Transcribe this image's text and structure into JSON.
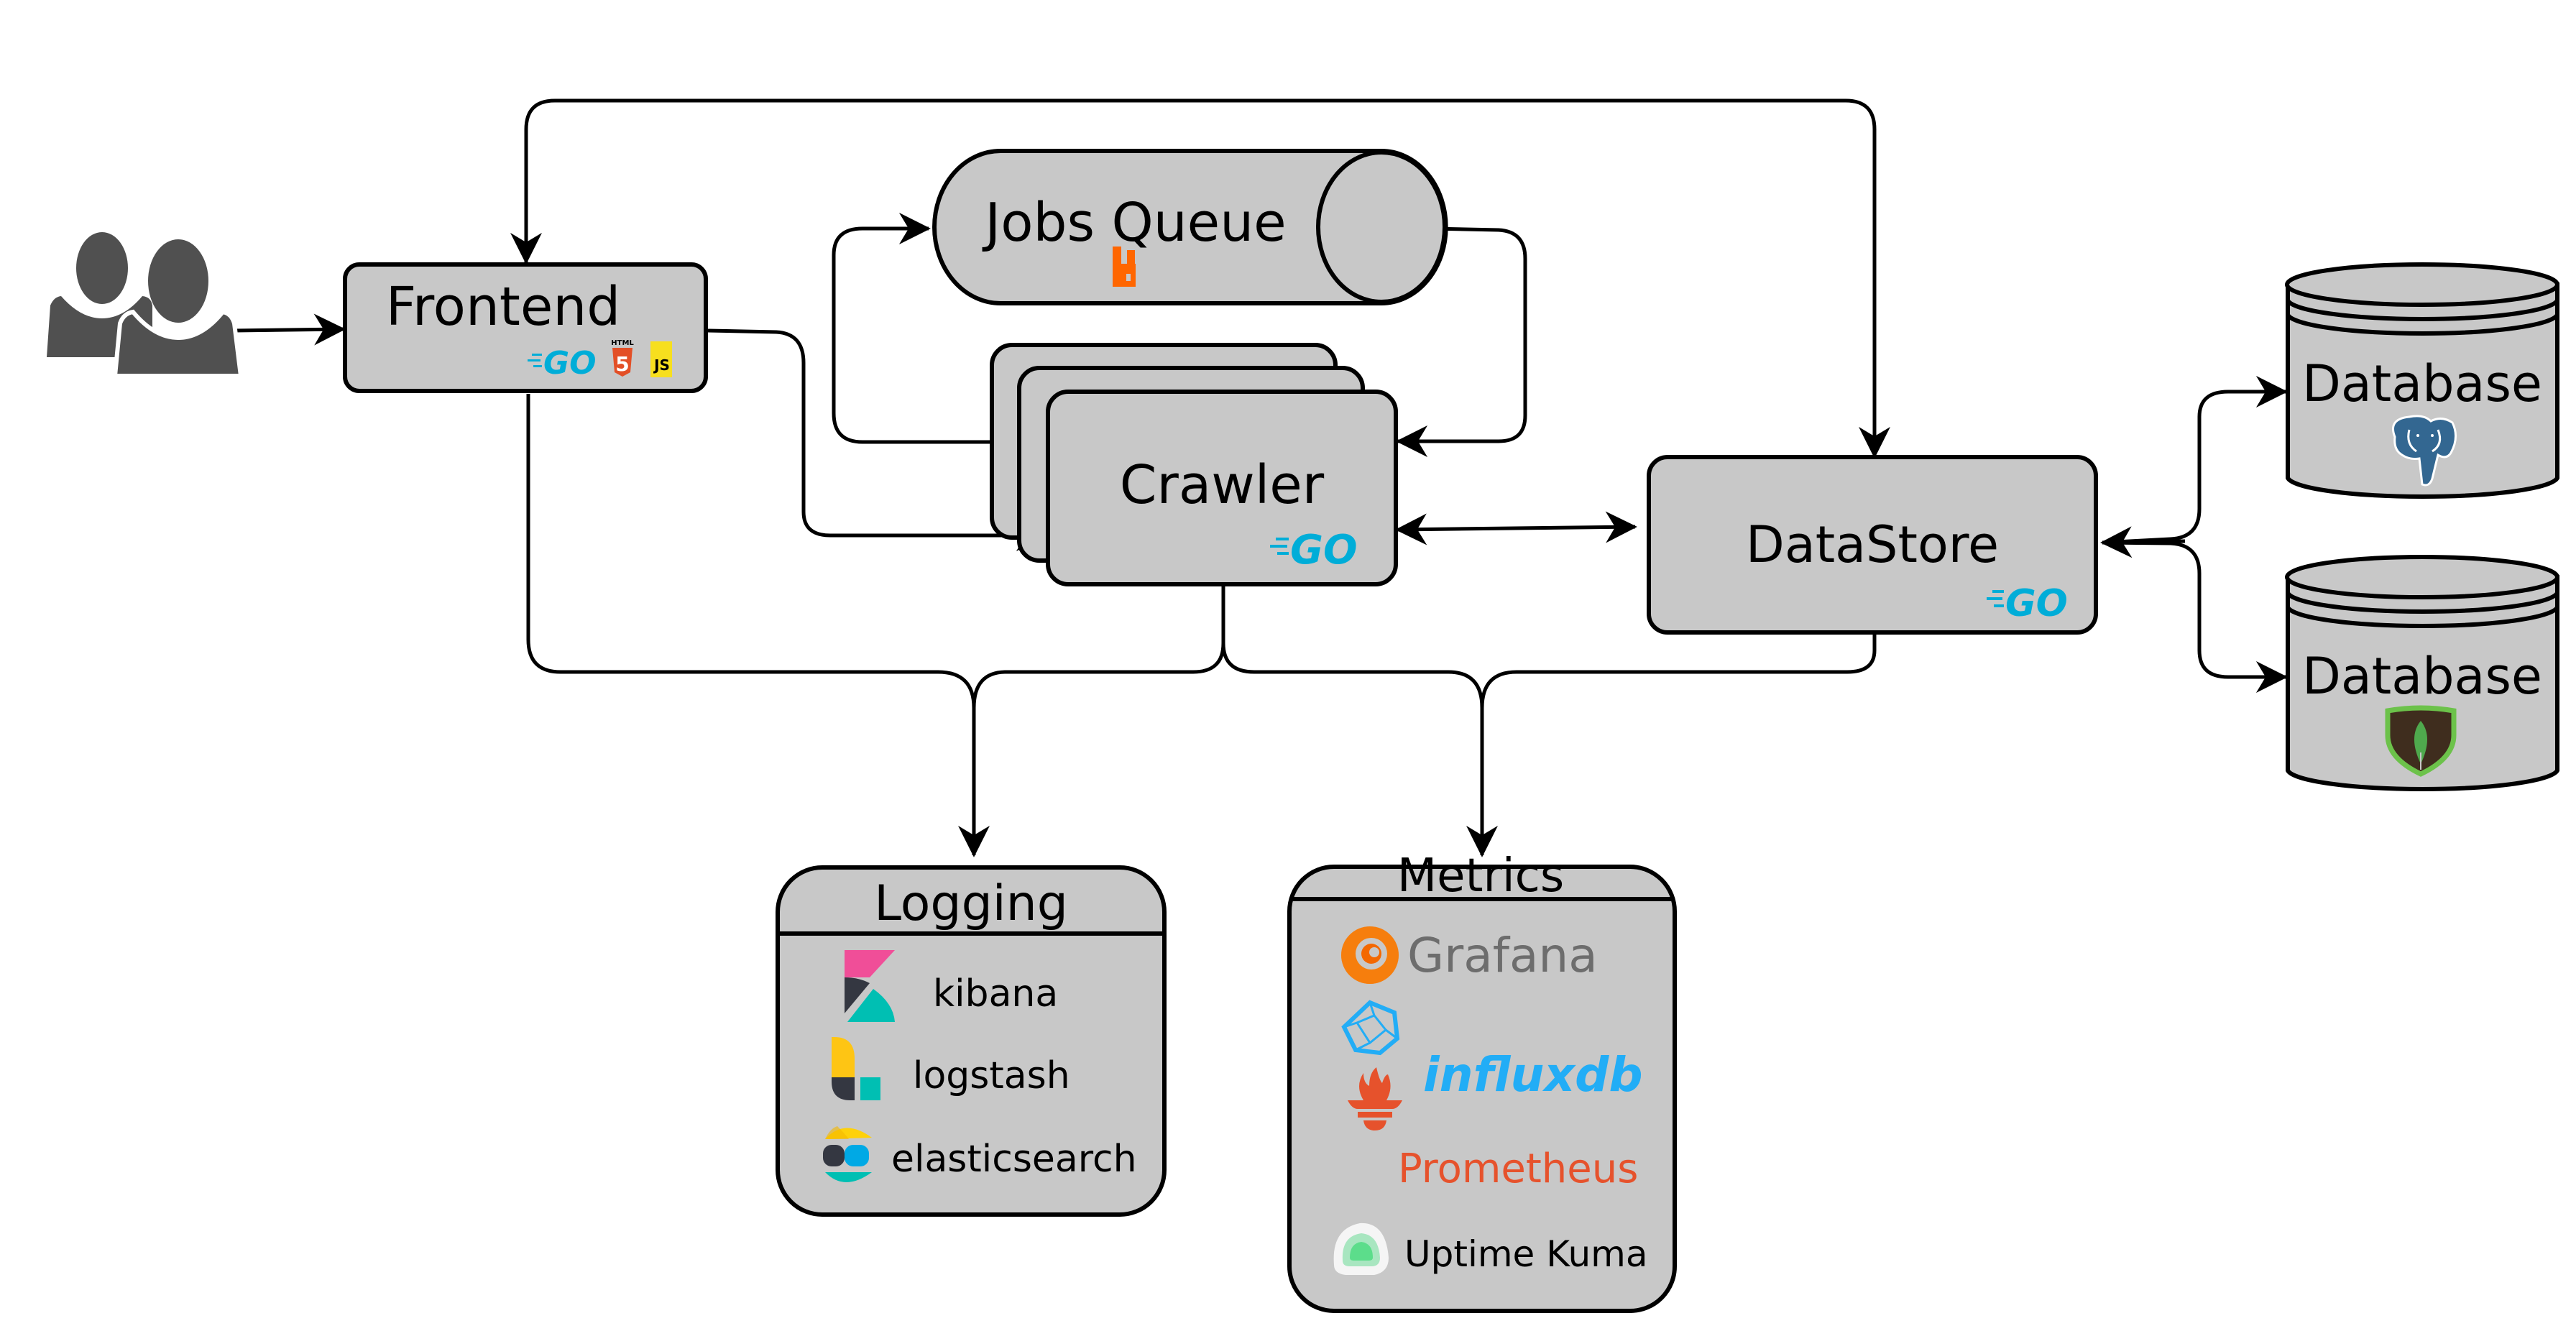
{
  "users": {
    "icon": "users-icon"
  },
  "frontend": {
    "label": "Frontend",
    "tech": [
      "go-logo",
      "html5-logo",
      "javascript-logo"
    ],
    "html5_caption": "HTML",
    "html5_digit": "5",
    "js_text": "JS"
  },
  "jobs_queue": {
    "label": "Jobs Queue",
    "tech": [
      "rabbitmq-logo"
    ]
  },
  "crawler": {
    "label": "Crawler",
    "tech": [
      "go-logo"
    ],
    "instances_shown": 3
  },
  "datastore": {
    "label": "DataStore",
    "tech": [
      "go-logo"
    ]
  },
  "databases": [
    {
      "label": "Database",
      "tech": "postgresql-logo"
    },
    {
      "label": "Database",
      "tech": "mongodb-logo"
    }
  ],
  "logging": {
    "title": "Logging",
    "tools": [
      {
        "name": "kibana",
        "icon": "kibana-logo"
      },
      {
        "name": "logstash",
        "icon": "logstash-logo"
      },
      {
        "name": "elasticsearch",
        "icon": "elasticsearch-logo"
      }
    ]
  },
  "metrics": {
    "title": "Metrics",
    "tools": [
      {
        "name": "Grafana",
        "icon": "grafana-logo",
        "color": "#6d6d6d"
      },
      {
        "name": "influxdb",
        "icon": "influxdb-logo",
        "color": "#22adf6"
      },
      {
        "name": "Prometheus",
        "icon": "prometheus-logo",
        "color": "#e6522c"
      },
      {
        "name": "Uptime Kuma",
        "icon": "uptime-kuma-logo",
        "color": "#000000"
      }
    ]
  },
  "go_text": "GO",
  "colors": {
    "node_fill": "#c8c8c8",
    "stroke": "#000000",
    "go_blue": "#00add8",
    "rabbit_orange": "#ff6600",
    "pg_blue": "#336791",
    "mongo_brown": "#3f2d1e",
    "mongo_green": "#4fa94d"
  }
}
